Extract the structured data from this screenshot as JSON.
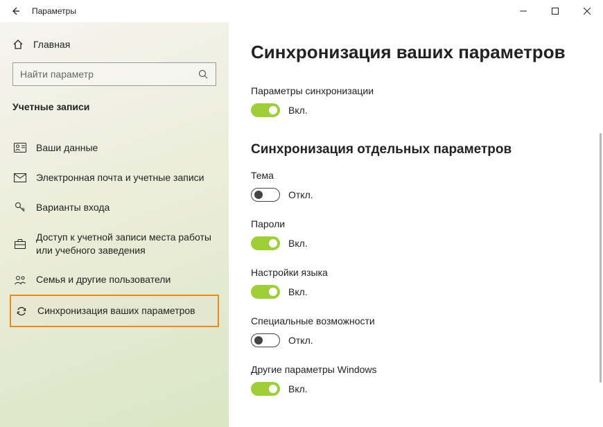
{
  "titlebar": {
    "title": "Параметры"
  },
  "sidebar": {
    "home_label": "Главная",
    "search_placeholder": "Найти параметр",
    "category": "Учетные записи",
    "items": [
      {
        "label": "Ваши данные"
      },
      {
        "label": "Электронная почта и учетные записи"
      },
      {
        "label": "Варианты входа"
      },
      {
        "label": "Доступ к учетной записи места работы или учебного заведения"
      },
      {
        "label": "Семья и другие пользователи"
      },
      {
        "label": "Синхронизация ваших параметров"
      }
    ]
  },
  "main": {
    "title": "Синхронизация ваших параметров",
    "sync_settings_label": "Параметры синхронизации",
    "section_title": "Синхронизация отдельных параметров",
    "on_text": "Вкл.",
    "off_text": "Откл.",
    "toggles": [
      {
        "label": "Тема",
        "on": false
      },
      {
        "label": "Пароли",
        "on": true
      },
      {
        "label": "Настройки языка",
        "on": true
      },
      {
        "label": "Специальные возможности",
        "on": false
      },
      {
        "label": "Другие параметры Windows",
        "on": true
      }
    ]
  }
}
